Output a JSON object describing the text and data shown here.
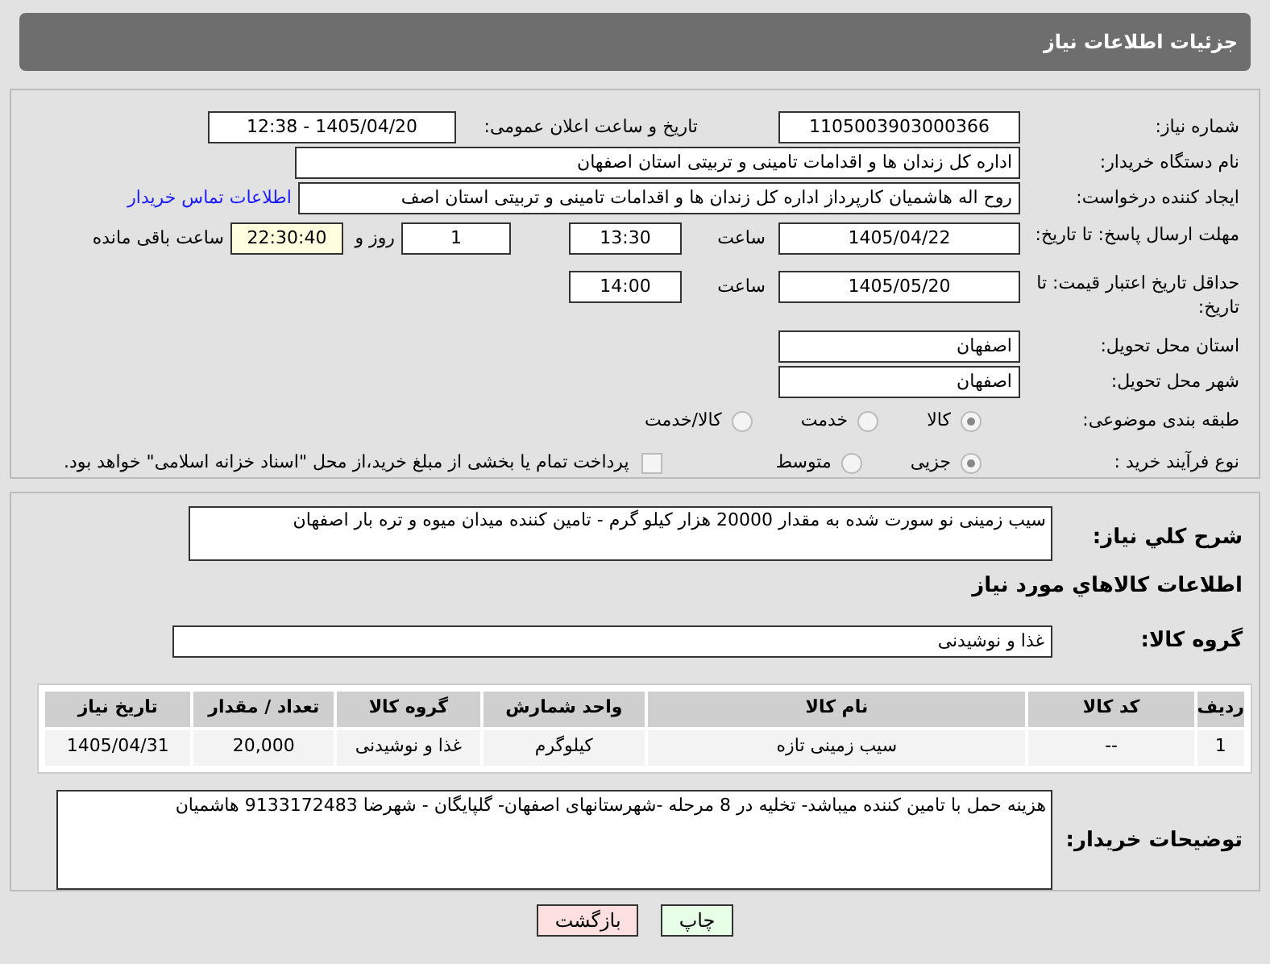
{
  "header": {
    "title": "جزئیات اطلاعات نیاز"
  },
  "info": {
    "number_label": "شماره نیاز:",
    "number": "1105003903000366",
    "announce_label": "تاریخ و ساعت اعلان عمومی:",
    "announce": "1405/04/20 - 12:38",
    "buyer_label": "نام دستگاه خریدار:",
    "buyer": "اداره کل زندان ها و اقدامات تامینی و تربیتی استان اصفهان",
    "requester_label": "ایجاد کننده درخواست:",
    "requester": "روح اله هاشمیان کارپرداز اداره کل زندان ها و اقدامات تامینی و تربیتی استان اصف",
    "contact_link": "اطلاعات تماس خریدار",
    "deadline_label": "مهلت ارسال پاسخ: تا تاریخ:",
    "deadline_date": "1405/04/22",
    "time_label": "ساعت",
    "deadline_time": "13:30",
    "days": "1",
    "days_label": "روز و",
    "remaining": "22:30:40",
    "remaining_label": "ساعت باقی مانده",
    "validity_label": "حداقل تاریخ اعتبار قیمت: تا تاریخ:",
    "validity_date": "1405/05/20",
    "validity_time_label": "ساعت",
    "validity_time": "14:00",
    "province_label": "استان محل تحویل:",
    "province": "اصفهان",
    "city_label": "شهر محل تحویل:",
    "city": "اصفهان",
    "category_label": "طبقه بندی موضوعی:",
    "category_options": [
      {
        "label": "کالا",
        "selected": true
      },
      {
        "label": "خدمت",
        "selected": false
      },
      {
        "label": "کالا/خدمت",
        "selected": false
      }
    ],
    "process_label": "نوع فرآیند خرید :",
    "process_options": [
      {
        "label": "جزیی",
        "selected": true
      },
      {
        "label": "متوسط",
        "selected": false
      }
    ],
    "payment": {
      "label": "پرداخت تمام یا بخشی از مبلغ خرید،از محل \"اسناد خزانه اسلامی\" خواهد بود.",
      "checked": false
    }
  },
  "details": {
    "summary_label": "شرح کلي نياز:",
    "summary": "سیب زمینی نو سورت شده به مقدار 20000 هزار کیلو گرم - تامین کننده میدان میوه و تره بار اصفهان",
    "goods_heading": "اطلاعات کالاهاي مورد نياز",
    "group_label": "گروه کالا:",
    "group": "غذا و نوشیدنی",
    "table": {
      "columns": [
        "ردیف",
        "کد کالا",
        "نام کالا",
        "واحد شمارش",
        "گروه کالا",
        "تعداد / مقدار",
        "تاریخ نیاز"
      ],
      "rows": [
        [
          "1",
          "--",
          "سیب زمینی تازه",
          "کیلوگرم",
          "غذا و نوشیدنی",
          "20,000",
          "1405/04/31"
        ]
      ]
    },
    "notes_label": "توضیحات خریدار:",
    "notes": "هزینه حمل با تامین کننده میباشد- تخلیه در 8 مرحله -شهرستانهای اصفهان- گلپایگان - شهرضا 9133172483 هاشمیان"
  },
  "buttons": [
    {
      "label": "چاپ",
      "kind": "print"
    },
    {
      "label": "بازگشت",
      "kind": "back"
    }
  ]
}
